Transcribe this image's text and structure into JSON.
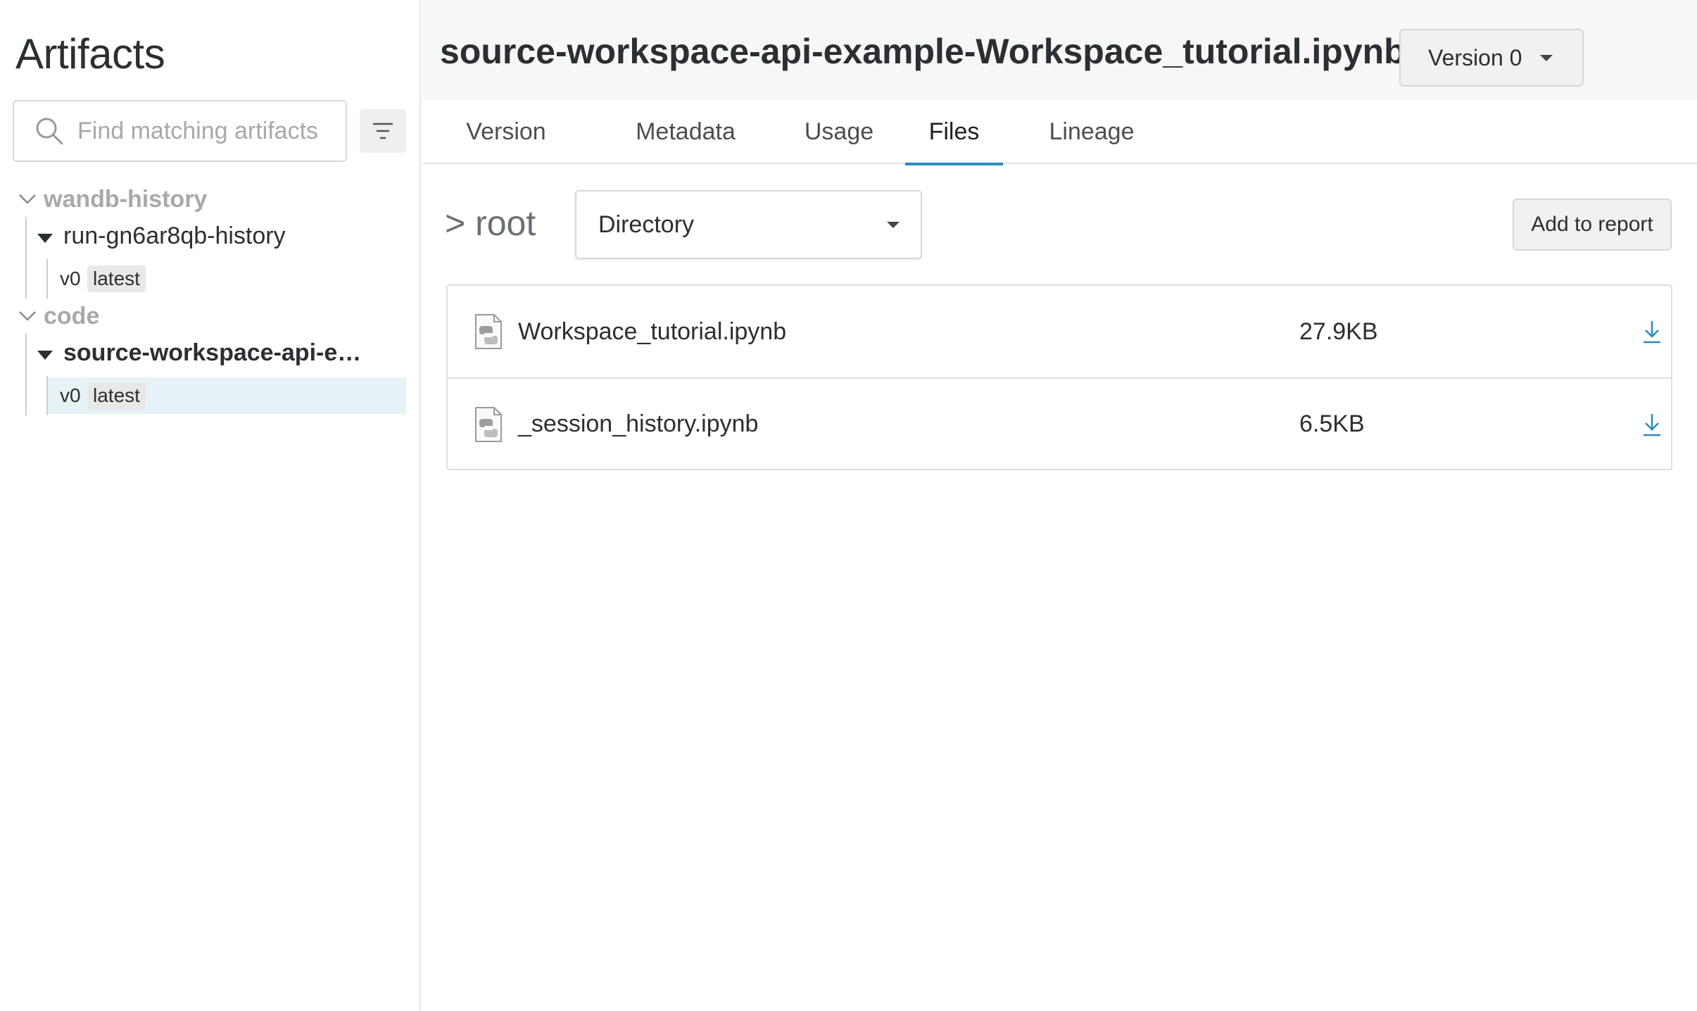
{
  "sidebar": {
    "title": "Artifacts",
    "search": {
      "placeholder": "Find matching artifacts",
      "value": "",
      "icon": "search-icon"
    },
    "filter_icon": "filter-icon",
    "groups": [
      {
        "label": "wandb-history",
        "artifacts": [
          {
            "label": "run-gn6ar8qb-history",
            "versions": [
              {
                "name": "v0",
                "tag": "latest",
                "selected": false
              }
            ]
          }
        ]
      },
      {
        "label": "code",
        "artifacts": [
          {
            "label": "source-workspace-api-example-Workspace_tutorial.ipynb",
            "versions": [
              {
                "name": "v0",
                "tag": "latest",
                "selected": true
              }
            ]
          }
        ]
      }
    ]
  },
  "header": {
    "title": "source-workspace-api-example-Workspace_tutorial.ipynb",
    "version_select": "Version 0"
  },
  "tabs": [
    {
      "label": "Version",
      "active": false
    },
    {
      "label": "Metadata",
      "active": false
    },
    {
      "label": "Usage",
      "active": false
    },
    {
      "label": "Files",
      "active": true
    },
    {
      "label": "Lineage",
      "active": false
    }
  ],
  "files_view": {
    "path": "> root",
    "view_select": "Directory",
    "add_to_report": "Add to report",
    "files": [
      {
        "name": "Workspace_tutorial.ipynb",
        "size": "27.9KB",
        "icon": "python-file-icon"
      },
      {
        "name": "_session_history.ipynb",
        "size": "6.5KB",
        "icon": "python-file-icon"
      }
    ]
  },
  "colors": {
    "accent": "#2a8bbf",
    "selected_row": "#e6f2f6",
    "header_bg": "#f7f7f7"
  }
}
